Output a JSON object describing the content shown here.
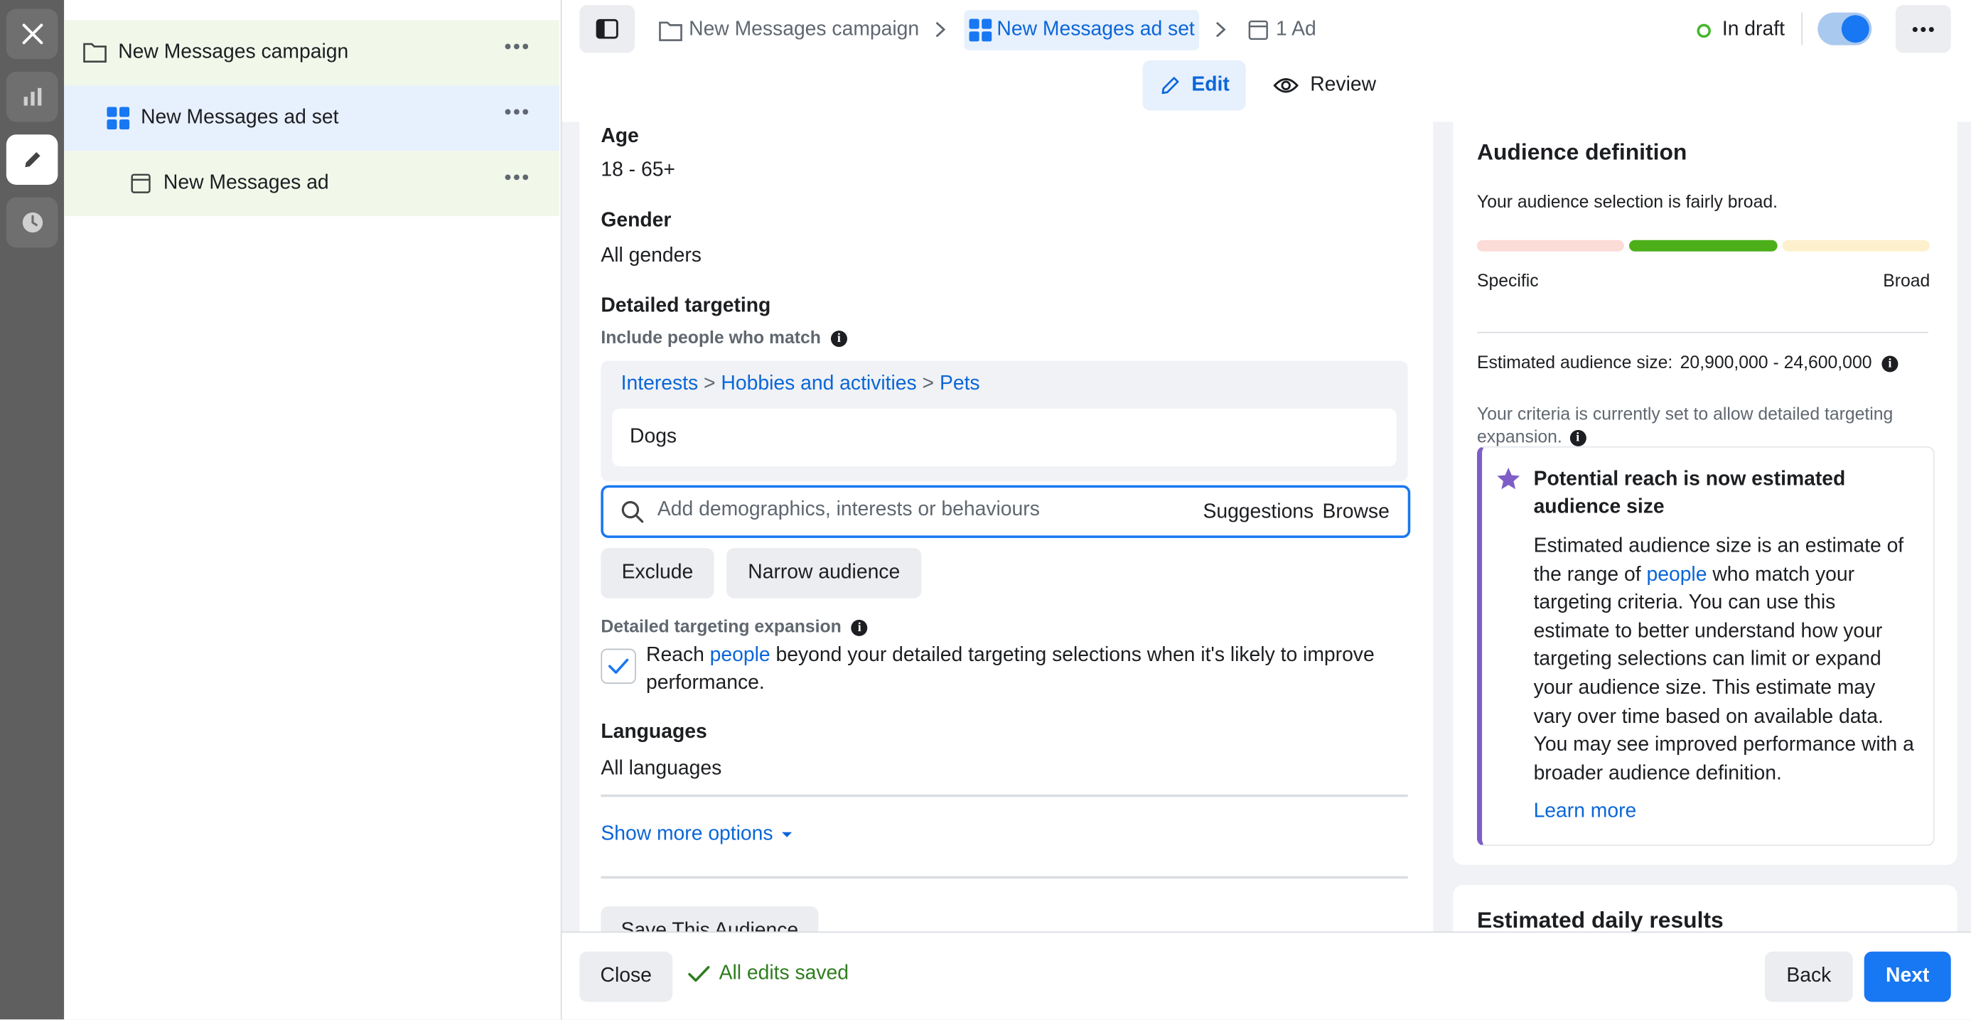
{
  "tree": {
    "items": [
      {
        "label": "New Messages campaign"
      },
      {
        "label": "New Messages ad set"
      },
      {
        "label": "New Messages ad"
      }
    ]
  },
  "header": {
    "breadcrumbs": [
      "New Messages campaign",
      "New Messages ad set",
      "1 Ad"
    ],
    "status": "In draft",
    "edit_label": "Edit",
    "review_label": "Review"
  },
  "targeting": {
    "age_label": "Age",
    "age_value": "18 - 65+",
    "gender_label": "Gender",
    "gender_value": "All genders",
    "detailed_label": "Detailed targeting",
    "include_label": "Include people who match",
    "path": [
      "Interests",
      "Hobbies and activities",
      "Pets"
    ],
    "path_sep": ">",
    "selected": "Dogs",
    "search_placeholder": "Add demographics, interests or behaviours",
    "suggestions_label": "Suggestions",
    "browse_label": "Browse",
    "exclude_label": "Exclude",
    "narrow_label": "Narrow audience",
    "expansion_label": "Detailed targeting expansion",
    "expansion_text_pre": "Reach",
    "expansion_link": "people",
    "expansion_text_post": "beyond your detailed targeting selections when it's likely to improve",
    "expansion_text_line2": "performance.",
    "languages_label": "Languages",
    "languages_value": "All languages",
    "show_more": "Show more options",
    "save_audience": "Save This Audience"
  },
  "audience": {
    "title": "Audience definition",
    "subtitle": "Your audience selection is fairly broad.",
    "specific": "Specific",
    "broad": "Broad",
    "breadth_level": 0.5,
    "size_label": "Estimated audience size:",
    "size_value": "20,900,000 - 24,600,000",
    "criteria_line1": "Your criteria is currently set to allow detailed targeting",
    "criteria_line2": "expansion.",
    "notice_title_1": "Potential reach is now estimated",
    "notice_title_2": "audience size",
    "notice_body": [
      "Estimated audience size is an estimate of",
      "the range of",
      "people",
      "who match your",
      "targeting criteria. You can use this",
      "estimate to better understand how your",
      "targeting selections can limit or expand",
      "your audience size. This estimate may",
      "vary over time based on available data.",
      "You may see improved performance with a",
      "broader audience definition."
    ],
    "learn_more": "Learn more",
    "daily_title": "Estimated daily results"
  },
  "footer": {
    "close_label": "Close",
    "saved_label": "All edits saved",
    "back_label": "Back",
    "next_label": "Next"
  },
  "colors": {
    "accent": "#0a66d8",
    "green": "#4caf1a",
    "tree_green_bg": "#f1f8ea",
    "tree_blue_bg": "#e7f0fd",
    "purple": "#7e5ec6"
  }
}
